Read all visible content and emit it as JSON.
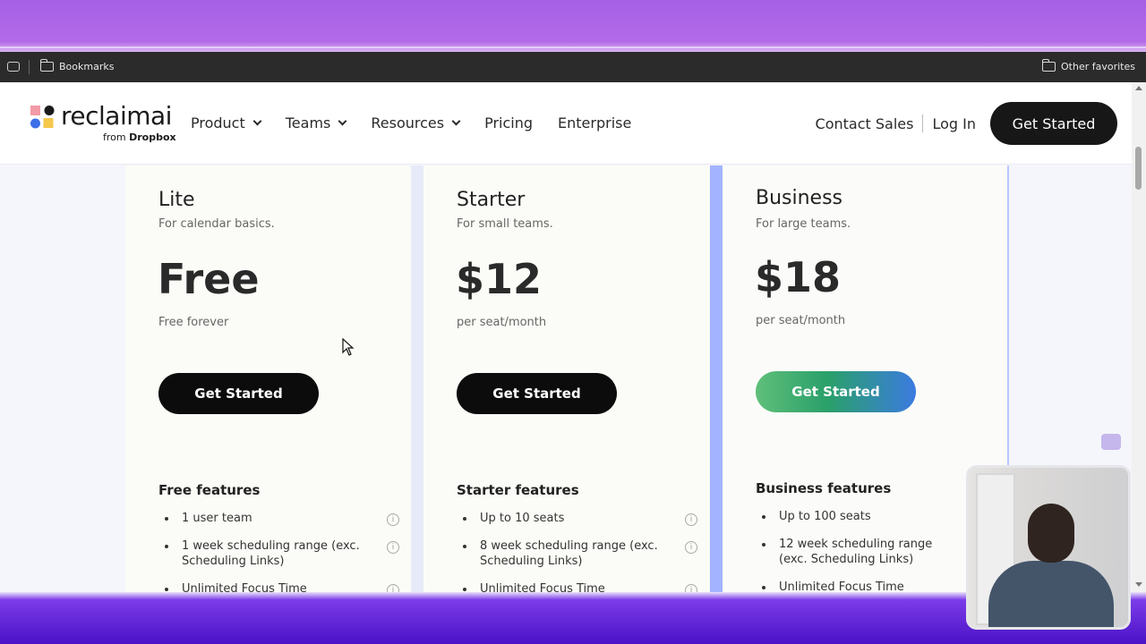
{
  "bookmarks_bar": {
    "left_folder": "Bookmarks",
    "right_folder": "Other favorites"
  },
  "header": {
    "logo_text": "reclaimai",
    "logo_sub_prefix": "from ",
    "logo_sub_brand": "Dropbox",
    "nav": [
      "Product",
      "Teams",
      "Resources",
      "Pricing",
      "Enterprise"
    ],
    "contact_sales": "Contact Sales",
    "login": "Log In",
    "cta": "Get Started"
  },
  "plans": [
    {
      "name": "Lite",
      "subtitle": "For calendar basics.",
      "price": "Free",
      "note": "Free forever",
      "button": "Get Started",
      "features_title": "Free features",
      "features": [
        "1 user team",
        "1 week scheduling range (exc. Scheduling Links)",
        "Unlimited Focus Time"
      ]
    },
    {
      "name": "Starter",
      "subtitle": "For small teams.",
      "price": "$12",
      "note": "per seat/month",
      "button": "Get Started",
      "features_title": "Starter features",
      "features": [
        "Up to 10 seats",
        "8 week scheduling range (exc. Scheduling Links)",
        "Unlimited Focus Time"
      ]
    },
    {
      "name": "Business",
      "subtitle": "For large teams.",
      "price": "$18",
      "note": "per seat/month",
      "button": "Get Started",
      "features_title": "Business features",
      "features": [
        "Up to 100 seats",
        "12 week scheduling range (exc. Scheduling Links)",
        "Unlimited Focus Time"
      ]
    }
  ],
  "colors": {
    "cta_dark": "#0c0c0c",
    "business_accent": "#a3b3ff",
    "business_button_gradient": [
      "#5fbf7a",
      "#2aa06a",
      "#3b7be0"
    ]
  }
}
